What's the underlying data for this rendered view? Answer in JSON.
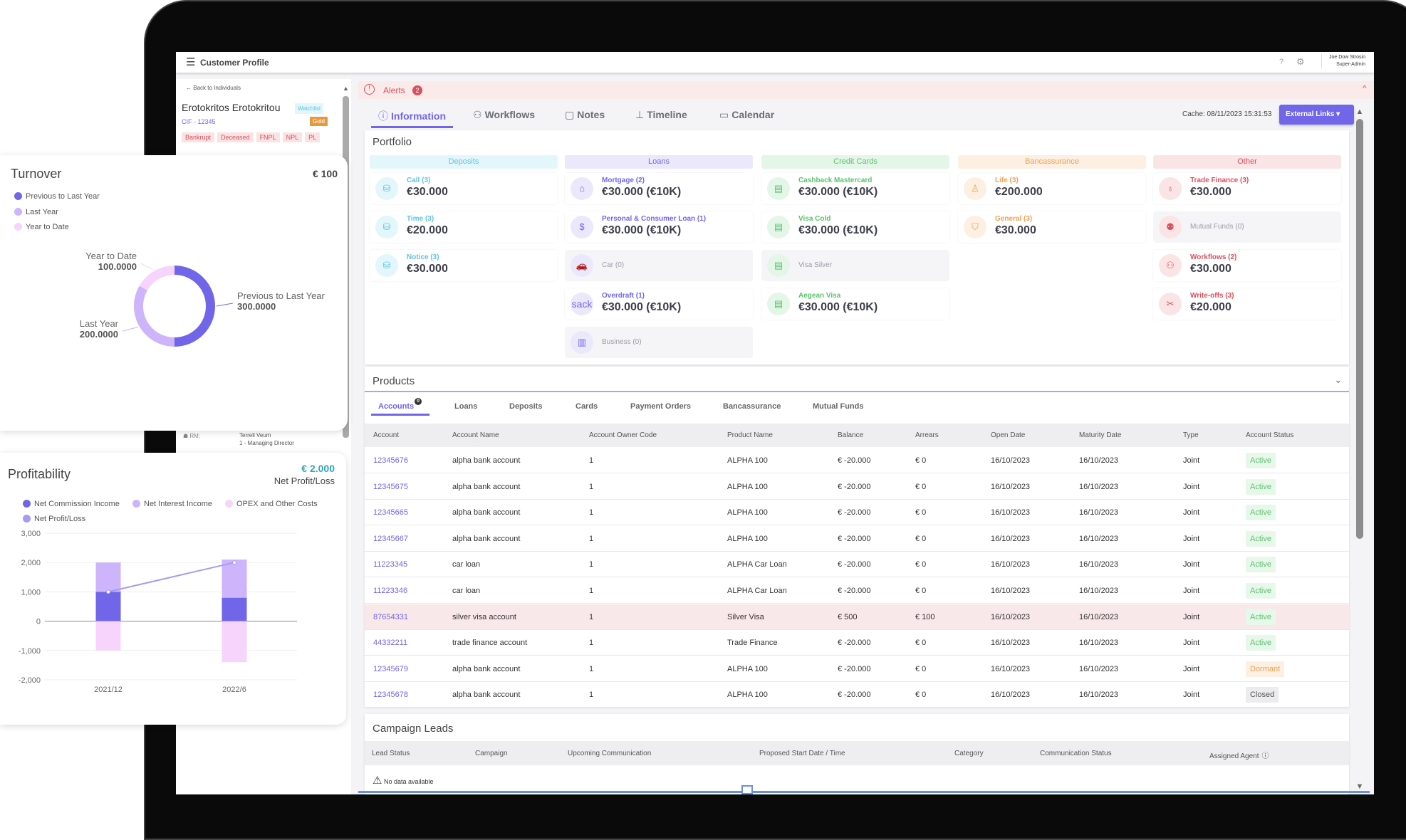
{
  "colors": {
    "accent": "#7166ea",
    "alert": "#d9505d",
    "active": "#5cc26e",
    "dormant": "#f0a054"
  },
  "topbar": {
    "menu_icon": "hamburger-icon",
    "title": "Customer Profile",
    "help": "?",
    "settings_icon": "gear-icon",
    "user_name": "Joe Dow Strosin",
    "user_role": "Super-Admin"
  },
  "sidebar": {
    "back": "Back to Individuals",
    "name": "Erotokritos Erotokritou",
    "watchlist": "Watchlist",
    "cif": "CIF - 12345",
    "tier": "Gold",
    "tags": [
      "Bankrupt",
      "Deceased",
      "FNPL",
      "NPL",
      "PL"
    ],
    "rm_label": "RM:",
    "rm_name": "Terrell Veum",
    "rm_role": "1 - Managing Director"
  },
  "alerts": {
    "label": "Alerts",
    "count": "2"
  },
  "tabs": [
    {
      "label": "Information",
      "icon": "info-icon",
      "active": true
    },
    {
      "label": "Workflows",
      "icon": "workflow-icon"
    },
    {
      "label": "Notes",
      "icon": "note-icon"
    },
    {
      "label": "Timeline",
      "icon": "timeline-icon"
    },
    {
      "label": "Calendar",
      "icon": "calendar-icon"
    }
  ],
  "cache": "Cache: 08/11/2023 15:31:53",
  "external_links": "External Links",
  "portfolio": {
    "title": "Portfolio",
    "columns": [
      {
        "label": "Deposits",
        "bg": "#e2f6fb",
        "fg": "#5fc3e3",
        "items": [
          {
            "label": "Call (3)",
            "value": "€30.000",
            "icon": "coins-icon"
          },
          {
            "label": "Time (3)",
            "value": "€20.000",
            "icon": "coins-icon"
          },
          {
            "label": "Notice (3)",
            "value": "€30.000",
            "icon": "coins-icon"
          }
        ]
      },
      {
        "label": "Loans",
        "bg": "#ebe8fc",
        "fg": "#7166ea",
        "items": [
          {
            "label": "Mortgage (2)",
            "value": "€30.000 (€10K)",
            "icon": "house-icon"
          },
          {
            "label": "Personal & Consumer Loan (1)",
            "value": "€30.000 (€10K)",
            "icon": "hand-money-icon"
          },
          {
            "label": "Car (0)",
            "icon": "car-icon",
            "empty": true
          },
          {
            "label": "Overdraft (1)",
            "value": "€30.000 (€10K)",
            "icon": "sack-icon"
          },
          {
            "label": "Business (0)",
            "icon": "building-icon",
            "empty": true
          }
        ]
      },
      {
        "label": "Credit Cards",
        "bg": "#e4f6e8",
        "fg": "#5cc26e",
        "items": [
          {
            "label": "Cashback Mastercard",
            "value": "€30.000 (€10K)",
            "icon": "card-icon"
          },
          {
            "label": "Visa Cold",
            "value": "€30.000 (€10K)",
            "icon": "card-icon"
          },
          {
            "label": "Visa Silver",
            "icon": "card-icon",
            "empty": true
          },
          {
            "label": "Aegean Visa",
            "value": "€30.000 (€10K)",
            "icon": "card-icon"
          }
        ]
      },
      {
        "label": "Bancassurance",
        "bg": "#fdefe1",
        "fg": "#f0a054",
        "items": [
          {
            "label": "Life (3)",
            "value": "€200.000",
            "icon": "person-shield-icon"
          },
          {
            "label": "General (3)",
            "value": "€30.000",
            "icon": "shield-icon"
          }
        ]
      },
      {
        "label": "Other",
        "bg": "#fbe4e6",
        "fg": "#d9505d",
        "items": [
          {
            "label": "Trade Finance (3)",
            "value": "€30.000",
            "icon": "globe-icon"
          },
          {
            "label": "Mutual Funds (0)",
            "icon": "people-icon",
            "empty": true
          },
          {
            "label": "Workflows (2)",
            "value": "€30.000",
            "icon": "workflow-icon"
          },
          {
            "label": "Write-offs (3)",
            "value": "€20.000",
            "icon": "scissors-icon"
          }
        ]
      }
    ]
  },
  "products": {
    "title": "Products",
    "subtabs": [
      "Accounts",
      "Loans",
      "Deposits",
      "Cards",
      "Payment Orders",
      "Bancassurance",
      "Mutual Funds"
    ],
    "accounts_badge": "0",
    "columns": [
      "Account",
      "Account Name",
      "Account Owner Code",
      "Product Name",
      "Balance",
      "Arrears",
      "Open Date",
      "Maturity Date",
      "Type",
      "Account Status"
    ],
    "rows": [
      [
        "12345676",
        "alpha bank account",
        "1",
        "ALPHA 100",
        "€ -20.000",
        "€ 0",
        "16/10/2023",
        "16/10/2023",
        "Joint",
        "Active"
      ],
      [
        "12345675",
        "alpha bank account",
        "1",
        "ALPHA 100",
        "€ -20.000",
        "€ 0",
        "16/10/2023",
        "16/10/2023",
        "Joint",
        "Active"
      ],
      [
        "12345665",
        "alpha bank account",
        "1",
        "ALPHA 100",
        "€ -20.000",
        "€ 0",
        "16/10/2023",
        "16/10/2023",
        "Joint",
        "Active"
      ],
      [
        "12345667",
        "alpha bank account",
        "1",
        "ALPHA 100",
        "€ -20.000",
        "€ 0",
        "16/10/2023",
        "16/10/2023",
        "Joint",
        "Active"
      ],
      [
        "11223345",
        "car loan",
        "1",
        "ALPHA Car Loan",
        "€ -20.000",
        "€ 0",
        "16/10/2023",
        "16/10/2023",
        "Joint",
        "Active"
      ],
      [
        "11223346",
        "car loan",
        "1",
        "ALPHA Car Loan",
        "€ -20.000",
        "€ 0",
        "16/10/2023",
        "16/10/2023",
        "Joint",
        "Active"
      ],
      [
        "87654331",
        "silver visa account",
        "1",
        "Silver Visa",
        "€ 500",
        "€ 100",
        "16/10/2023",
        "16/10/2023",
        "Joint",
        "Active"
      ],
      [
        "44332211",
        "trade finance account",
        "1",
        "Trade Finance",
        "€ -20.000",
        "€ 0",
        "16/10/2023",
        "16/10/2023",
        "Joint",
        "Active"
      ],
      [
        "12345679",
        "alpha bank account",
        "1",
        "ALPHA 100",
        "€ -20.000",
        "€ 0",
        "16/10/2023",
        "16/10/2023",
        "Joint",
        "Dormant"
      ],
      [
        "12345678",
        "alpha bank account",
        "1",
        "ALPHA 100",
        "€ -20.000",
        "€ 0",
        "16/10/2023",
        "16/10/2023",
        "Joint",
        "Closed"
      ]
    ],
    "highlighted_row": 6
  },
  "campaign": {
    "title": "Campaign Leads",
    "columns": [
      "Lead Status",
      "Campaign",
      "Upcoming Communication",
      "Proposed Start Date / Time",
      "Category",
      "Communication Status",
      "Assigned Agent"
    ],
    "empty": "No data available"
  },
  "chart_data": [
    {
      "type": "pie",
      "variant": "donut",
      "title": "Turnover",
      "total": "€ 100",
      "categories": [
        "Previous to Last Year",
        "Last Year",
        "Year to Date"
      ],
      "values": [
        300,
        200,
        100
      ],
      "value_labels": [
        "300.0000",
        "200.0000",
        "100.0000"
      ],
      "colors": [
        "#7166ea",
        "#cdb4fb",
        "#f7d4fb"
      ],
      "legend": "top-left"
    },
    {
      "type": "bar",
      "stacked": true,
      "title": "Profitability",
      "summary_value": "€ 2.000",
      "summary_label": "Net Profit/Loss",
      "categories": [
        "2021/12",
        "2022/6"
      ],
      "series": [
        {
          "name": "Net Commission Income",
          "values": [
            1000,
            800
          ],
          "color": "#7166ea"
        },
        {
          "name": "Net Interest Income",
          "values": [
            1000,
            1300
          ],
          "color": "#cdb4fb"
        },
        {
          "name": "OPEX and Other Costs",
          "values": [
            -1000,
            -1400
          ],
          "color": "#f7d4fb"
        },
        {
          "name": "Net Profit/Loss",
          "type": "line",
          "values": [
            1000,
            2000
          ],
          "color": "#a59bf5"
        }
      ],
      "ylim": [
        -2000,
        3000
      ],
      "yticks": [
        "3,000",
        "2,000",
        "1,000",
        "0",
        "-1,000",
        "-2,000"
      ],
      "grid": true,
      "legend": "top"
    }
  ]
}
